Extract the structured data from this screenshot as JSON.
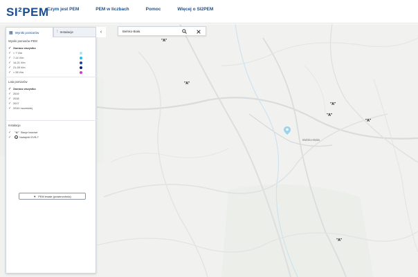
{
  "header": {
    "logo_text": "SI²PEM",
    "nav": [
      "Czym jest PEM",
      "PEM w liczbach",
      "Pomoc",
      "Więcej o SI2PEM"
    ]
  },
  "panel": {
    "tab_active": "Wyniki pomiarów",
    "tab_inactive": "Instalacje",
    "collapse": "‹",
    "section_levels": "Wyniki pomiarów PEM",
    "levels": [
      {
        "label": "Zaznacz wszystko",
        "color": ""
      },
      {
        "label": "< 7 V/m",
        "color": "#a8e5f5"
      },
      {
        "label": "7-14 V/m",
        "color": "#19c0e6"
      },
      {
        "label": "14-21 V/m",
        "color": "#1f3ea8"
      },
      {
        "label": "21-28 V/m",
        "color": "#0c1f73"
      },
      {
        "label": "> 28 V/m",
        "color": "#d23ac9"
      }
    ],
    "section_years": "Lata pomiarów",
    "years": [
      "Zaznacz wszystko",
      "2019",
      "2018",
      "2017",
      "2016 i wcześniej"
    ],
    "section_inst": "Instalacje",
    "inst": [
      "Stacje bazowe",
      "Nadajniki DVB-T"
    ],
    "pem_button": "PEM trwałe (powierzchnia)"
  },
  "search": {
    "value": "Bielsko-Biała",
    "search_icon": "search-icon",
    "clear_icon": "close-icon"
  },
  "map": {
    "antenna_label": "A",
    "city_label": "Bielsko-Biała"
  },
  "colors": {
    "brand": "#1a4d8f",
    "accent": "#2bb6e6"
  }
}
